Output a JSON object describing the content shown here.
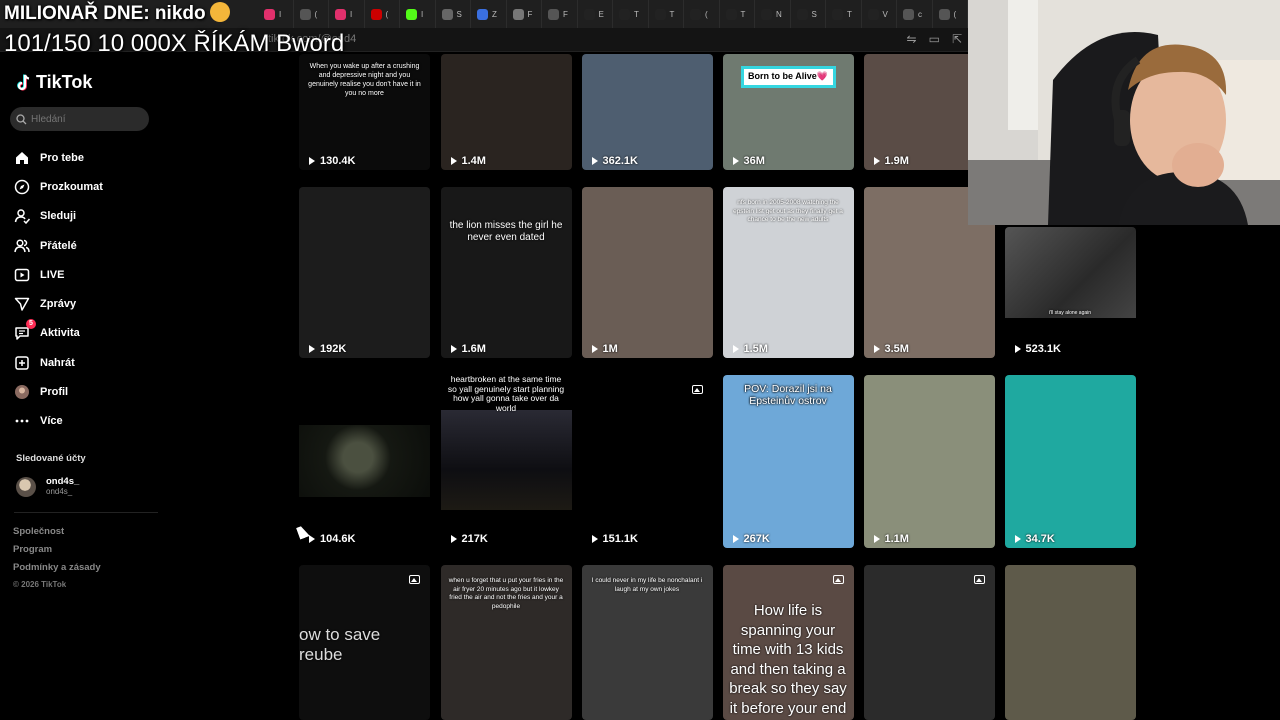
{
  "overlay": {
    "line1": "MILIONAŘ DNE: nikdo",
    "line2": "101/150 10 000X ŘÍKÁM Bword"
  },
  "browser": {
    "url_fragment": "tiktok.com/@ond4",
    "tabs": [
      {
        "letter": "I",
        "color": "#e1306c"
      },
      {
        "letter": "(",
        "color": "#555555"
      },
      {
        "letter": "I",
        "color": "#e1306c"
      },
      {
        "letter": "(",
        "color": "#cc0000"
      },
      {
        "letter": "I",
        "color": "#53fc18"
      },
      {
        "letter": "S",
        "color": "#666666"
      },
      {
        "letter": "Z",
        "color": "#3a6fe0"
      },
      {
        "letter": "F",
        "color": "#777777"
      },
      {
        "letter": "F",
        "color": "#555555"
      },
      {
        "letter": "E",
        "color": "#222222"
      },
      {
        "letter": "T",
        "color": "#222222"
      },
      {
        "letter": "T",
        "color": "#222222"
      },
      {
        "letter": "(",
        "color": "#222222"
      },
      {
        "letter": "T",
        "color": "#222222"
      },
      {
        "letter": "N",
        "color": "#222222"
      },
      {
        "letter": "S",
        "color": "#222222"
      },
      {
        "letter": "T",
        "color": "#222222"
      },
      {
        "letter": "V",
        "color": "#222222"
      },
      {
        "letter": "c",
        "color": "#555555"
      },
      {
        "letter": "(",
        "color": "#555555"
      }
    ]
  },
  "sidebar": {
    "logo": "TikTok",
    "search_placeholder": "Hledání",
    "nav": [
      {
        "label": "Pro tebe",
        "icon": "home-icon"
      },
      {
        "label": "Prozkoumat",
        "icon": "compass-icon"
      },
      {
        "label": "Sleduji",
        "icon": "following-icon"
      },
      {
        "label": "Přátelé",
        "icon": "friends-icon"
      },
      {
        "label": "LIVE",
        "icon": "live-icon"
      },
      {
        "label": "Zprávy",
        "icon": "messages-icon"
      },
      {
        "label": "Aktivita",
        "icon": "activity-icon",
        "badge": "5"
      },
      {
        "label": "Nahrát",
        "icon": "upload-icon"
      },
      {
        "label": "Profil",
        "icon": "profile-icon"
      },
      {
        "label": "Více",
        "icon": "more-icon"
      }
    ],
    "followed_title": "Sledované účty",
    "followed": [
      {
        "name": "ond4s_",
        "handle": "ond4s_"
      }
    ],
    "footer": [
      "Společnost",
      "Program",
      "Podmínky a zásady"
    ],
    "copyright": "© 2026 TikTok"
  },
  "videos": [
    {
      "views": "130.4K",
      "caption": "When you wake up after a crushing and depressive night and you genuinely realise you don't have it in you no more",
      "bg": "#0b0b0b"
    },
    {
      "views": "1.4M",
      "caption": "",
      "bg": "#2a2420"
    },
    {
      "views": "362.1K",
      "caption": "",
      "bg": "#4e5e70"
    },
    {
      "views": "36M",
      "caption": "Born to be Alive💗",
      "bg": "#6f7a70"
    },
    {
      "views": "1.9M",
      "caption": "",
      "bg": "#5a4c46"
    },
    {
      "views": "192K",
      "caption": "",
      "bg": "#1c1c1c"
    },
    {
      "views": "1.6M",
      "caption": "the lion misses the girl he never even dated",
      "bg": "#181818"
    },
    {
      "views": "1M",
      "caption": "",
      "bg": "#6a5d55"
    },
    {
      "views": "1.5M",
      "caption": "nfs born in 2005-2008 watching the epstein list get out as they finally get a chance to be the new adults",
      "bg": "#cfd2d6"
    },
    {
      "views": "3.5M",
      "caption": "",
      "bg": "#7d6e64"
    },
    {
      "views": "523.1K",
      "caption": "i'll stay alone again",
      "bg": "#3e3e3e"
    },
    {
      "views": "104.6K",
      "caption": "",
      "bg": "#0c0f0c"
    },
    {
      "views": "217K",
      "caption": "heartbroken at the same time so yall genuinely start planning how yall gonna take over da world",
      "bg": "#101014"
    },
    {
      "views": "151.1K",
      "caption": "",
      "bg": "#000000"
    },
    {
      "views": "267K",
      "caption": "POV: Dorazil jsi na Epsteinův ostrov",
      "bg": "#6ea8d8"
    },
    {
      "views": "1.1M",
      "caption": "",
      "bg": "#8a8f7a"
    },
    {
      "views": "34.7K",
      "caption": "",
      "bg": "#1fa9a0"
    },
    {
      "views": "",
      "caption": "ow to save reube",
      "bg": "#0e0e0e"
    },
    {
      "views": "",
      "caption": "when u forget that u put your fries in the air fryer 20 minutes ago but it lowkey fried the air and not the fries and your a pedophile",
      "bg": "#2e2a28"
    },
    {
      "views": "",
      "caption": "I could never in my life be nonchalant i laugh at my own jokes",
      "bg": "#3a3a3a"
    },
    {
      "views": "",
      "caption": "How life is spanning your time with 13 kids and then taking a break so they say it before your end minds",
      "bg": "#5a4a44"
    },
    {
      "views": "",
      "caption": "",
      "bg": "#2b2b2b"
    },
    {
      "views": "",
      "caption": "",
      "bg": "#5e5a4a"
    }
  ]
}
